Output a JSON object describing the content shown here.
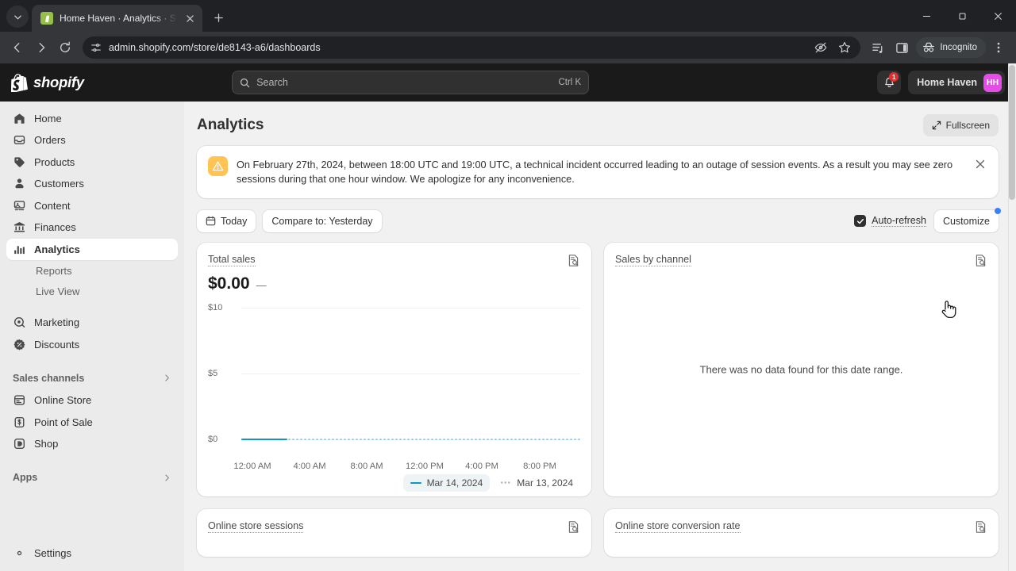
{
  "browser": {
    "tab": {
      "title": "Home Haven · Analytics · Shopi",
      "favicon": "shopify-bag-icon"
    },
    "new_tab_label": "+",
    "url": "admin.shopify.com/store/de8143-a6/dashboards",
    "incognito_label": "Incognito",
    "window_controls": {
      "minimize": "–",
      "maximize": "▢",
      "close": "✕"
    }
  },
  "topbar": {
    "brand": "shopify",
    "search": {
      "placeholder": "Search",
      "shortcut": "Ctrl K"
    },
    "notifications_count": "1",
    "store_name": "Home Haven",
    "avatar_initials": "HH"
  },
  "sidebar": {
    "items": [
      {
        "label": "Home",
        "icon": "home-icon"
      },
      {
        "label": "Orders",
        "icon": "orders-inbox-icon"
      },
      {
        "label": "Products",
        "icon": "tag-icon"
      },
      {
        "label": "Customers",
        "icon": "person-icon"
      },
      {
        "label": "Content",
        "icon": "content-image-icon"
      },
      {
        "label": "Finances",
        "icon": "bank-icon"
      },
      {
        "label": "Analytics",
        "icon": "bar-chart-icon",
        "active": true
      }
    ],
    "sub_items": [
      {
        "label": "Reports"
      },
      {
        "label": "Live View"
      }
    ],
    "items2": [
      {
        "label": "Marketing",
        "icon": "megaphone-target-icon"
      },
      {
        "label": "Discounts",
        "icon": "discount-badge-icon"
      }
    ],
    "sales_channels_label": "Sales channels",
    "channels": [
      {
        "label": "Online Store",
        "icon": "storefront-icon"
      },
      {
        "label": "Point of Sale",
        "icon": "pos-icon"
      },
      {
        "label": "Shop",
        "icon": "shop-icon"
      }
    ],
    "apps_label": "Apps",
    "settings_label": "Settings"
  },
  "main": {
    "page_title": "Analytics",
    "fullscreen_label": "Fullscreen",
    "banner": {
      "text": "On February 27th, 2024, between 18:00 UTC and 19:00 UTC, a technical incident occurred leading to an outage of session events. As a result you may see zero sessions during that one hour window. We apologize for any inconvenience.",
      "icon": "warning-triangle-icon",
      "close": "✕"
    },
    "filters": {
      "date_range": "Today",
      "compare": "Compare to: Yesterday",
      "auto_refresh_label": "Auto-refresh",
      "auto_refresh_checked": true,
      "customize_label": "Customize"
    },
    "cards": [
      {
        "title": "Total sales",
        "value": "$0.00",
        "delta": "—",
        "report_icon": "view-report-icon"
      },
      {
        "title": "Sales by channel",
        "empty_message": "There was no data found for this date range.",
        "report_icon": "view-report-icon"
      }
    ],
    "bottom_cards": [
      {
        "title": "Online store sessions",
        "report_icon": "view-report-icon"
      },
      {
        "title": "Online store conversion rate",
        "report_icon": "view-report-icon"
      }
    ]
  },
  "chart_data": {
    "type": "line",
    "title": "Total sales",
    "xlabel": "",
    "ylabel": "",
    "ylim": [
      0,
      10
    ],
    "yticks": [
      "$0",
      "$5",
      "$10"
    ],
    "ytick_values": [
      0,
      5,
      10
    ],
    "xticks": [
      "12:00 AM",
      "4:00 AM",
      "8:00 AM",
      "12:00 PM",
      "4:00 PM",
      "8:00 PM"
    ],
    "grid": true,
    "legend_position": "bottom-right",
    "series": [
      {
        "name": "Mar 14, 2024",
        "style": "solid",
        "color": "#0e97c9",
        "x": [
          "12:00 AM",
          "1:00 AM",
          "2:00 AM",
          "3:00 AM",
          "4:00 AM"
        ],
        "values": [
          0,
          0,
          0,
          0,
          0
        ]
      },
      {
        "name": "Mar 13, 2024",
        "style": "dotted",
        "color": "#7cc7ea",
        "x": [
          "4:00 AM",
          "8:00 AM",
          "12:00 PM",
          "4:00 PM",
          "8:00 PM",
          "11:00 PM"
        ],
        "values": [
          0,
          0,
          0,
          0,
          0,
          0
        ]
      }
    ]
  }
}
